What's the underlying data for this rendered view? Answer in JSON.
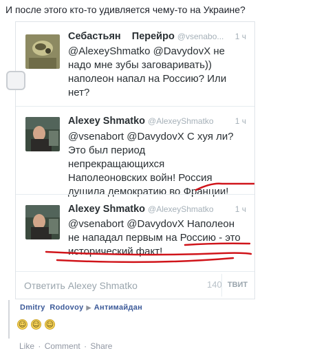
{
  "post": {
    "text": "И после этого кто-то удивляется чему-то на Украине?"
  },
  "tweets": [
    {
      "name": "Себастьян    Перейро",
      "handle": "@vsenabo...",
      "time": "1 ч",
      "lines": [
        "@AlexeyShmatko @DavydovX не",
        "надо мне зубы заговаривать))",
        "наполеон напал на Россию? Или",
        "нет?"
      ]
    },
    {
      "name": "Alexey Shmatko",
      "handle": "@AlexeyShmatko",
      "time": "1 ч",
      "lines": [
        "@vsenabort @DavydovX  С хуя ли?",
        "Это был период",
        "непрекращающихся",
        "Наполеоновских войн! Россия",
        "душила демократию во Франции!"
      ]
    },
    {
      "name": "Alexey Shmatko",
      "handle": "@AlexeyShmatko",
      "time": "1 ч",
      "lines": [
        "@vsenabort @DavydovX Наполеон",
        "не нападал первым на Россию - это",
        "исторический факт!"
      ]
    }
  ],
  "reply": {
    "placeholder": "Ответить Alexey Shmatko",
    "count": "140",
    "button": "ТВИТ"
  },
  "shared": {
    "author": "Dmitry  Rodovoy",
    "arrow": "▶",
    "target": "Антимайдан"
  },
  "reactions": {
    "emoji": "☺"
  },
  "actions": {
    "like": "Like",
    "comment": "Comment",
    "share": "Share",
    "sep": "·"
  },
  "colors": {
    "underline": "#d0141a",
    "link": "#3b5998"
  }
}
